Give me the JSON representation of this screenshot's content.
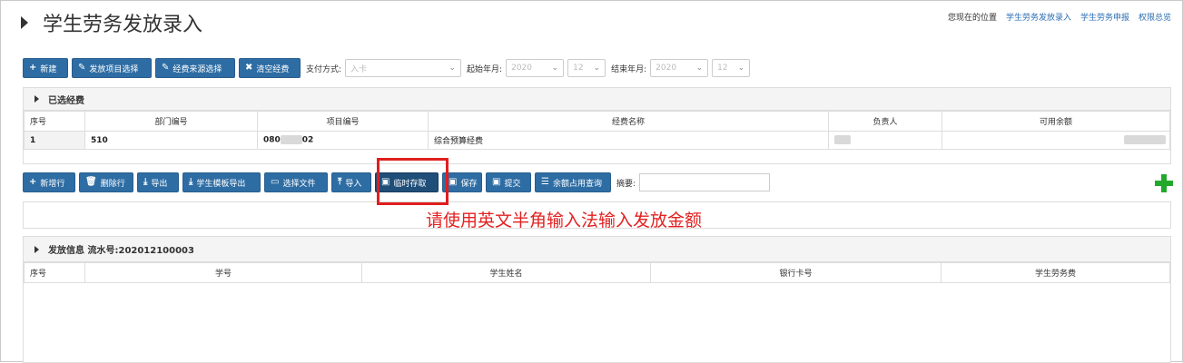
{
  "header": {
    "title": "学生劳务发放录入",
    "breadcrumb_label": "您现在的位置",
    "breadcrumb_links": [
      "学生劳务发放录入",
      "学生劳务申报",
      "权限总览"
    ]
  },
  "toolbar1": {
    "buttons": [
      "新建",
      "发放项目选择",
      "经费来源选择",
      "清空经费"
    ],
    "pay_method_label": "支付方式:",
    "pay_method_value": "入卡",
    "start_label": "起始年月:",
    "start_year": "2020",
    "start_month": "12",
    "end_label": "结束年月:",
    "end_year": "2020",
    "end_month": "12"
  },
  "funds_panel": {
    "title": "已选经费",
    "columns": [
      "序号",
      "部门编号",
      "项目编号",
      "经费名称",
      "负责人",
      "可用余额"
    ],
    "rows": [
      {
        "seq": "1",
        "dept": "510",
        "project_prefix": "080",
        "project_suffix": "02",
        "fund_name": "综合预算经费"
      }
    ]
  },
  "toolbar2": {
    "buttons": [
      "新增行",
      "删除行",
      "导出",
      "学生模板导出",
      "选择文件",
      "导入",
      "临时存取",
      "保存",
      "提交",
      "余额占用查询"
    ],
    "summary_label": "摘要:"
  },
  "notice": "请使用英文半角输入法输入发放金额",
  "payout_panel": {
    "title": "发放信息 流水号:202012100003",
    "columns": [
      "序号",
      "学号",
      "学生姓名",
      "银行卡号",
      "学生劳务费"
    ]
  },
  "colors": {
    "button_blue": "#2e6da4",
    "active_button": "#1f4e79",
    "highlight_red": "#e01e1e",
    "add_green": "#22a92b"
  }
}
